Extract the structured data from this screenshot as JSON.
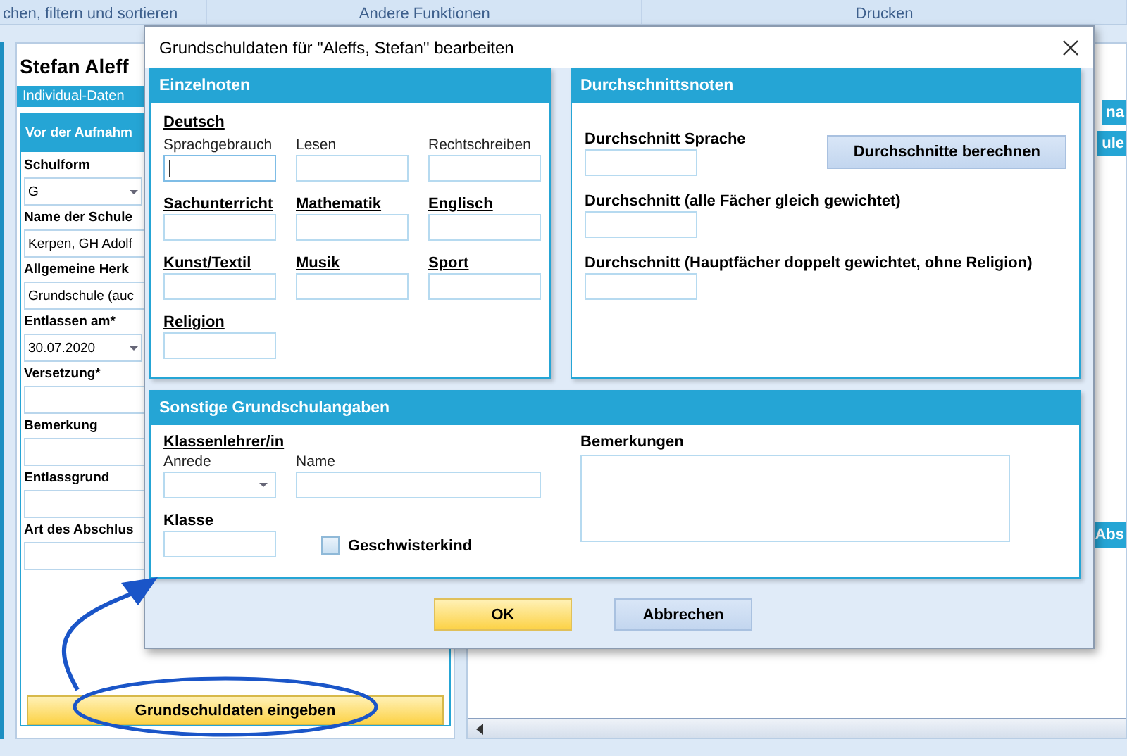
{
  "app": {
    "toolbar": [
      {
        "label": "chen, filtern und sortieren"
      },
      {
        "label": "Andere Funktionen"
      },
      {
        "label": "Drucken"
      }
    ],
    "student_name": "Stefan Aleff",
    "tab": "Individual-Daten",
    "section_title": "Vor der Aufnahm",
    "fields": [
      {
        "label": "Schulform",
        "value": "G",
        "kind": "select"
      },
      {
        "label": "Name der Schule",
        "value": "Kerpen, GH Adolf",
        "kind": "text"
      },
      {
        "label": "Allgemeine Herk",
        "value": "Grundschule (auc",
        "kind": "text"
      },
      {
        "label": "Entlassen am*",
        "value": "30.07.2020",
        "kind": "select"
      },
      {
        "label": "Versetzung*",
        "kind": "text"
      },
      {
        "label": "Bemerkung",
        "kind": "text"
      },
      {
        "label": "Entlassgrund",
        "kind": "text"
      },
      {
        "label": "Art des Abschlus",
        "kind": "text"
      }
    ],
    "action_button": "Grundschuldaten eingeben",
    "right_tabs": [
      "na",
      "ule",
      "Abs"
    ]
  },
  "dialog": {
    "title": "Grundschuldaten für \"Aleffs, Stefan\" bearbeiten",
    "einzelnoten": {
      "title": "Einzelnoten",
      "group_title": "Deutsch",
      "group_fields": [
        {
          "label": "Sprachgebrauch",
          "focused": true
        },
        {
          "label": "Lesen",
          "focused": false
        },
        {
          "label": "Rechtschreiben",
          "focused": false
        }
      ],
      "subjects": [
        {
          "label": "Sachunterricht"
        },
        {
          "label": "Mathematik"
        },
        {
          "label": "Englisch"
        },
        {
          "label": "Kunst/Textil"
        },
        {
          "label": "Musik"
        },
        {
          "label": "Sport"
        },
        {
          "label": "Religion"
        }
      ]
    },
    "durchschnitt": {
      "title": "Durchschnittsnoten",
      "button": "Durchschnitte berechnen",
      "items": [
        {
          "label": "Durchschnitt Sprache"
        },
        {
          "label": "Durchschnitt (alle Fächer gleich gewichtet)"
        },
        {
          "label": "Durchschnitt (Hauptfächer doppelt gewichtet, ohne Religion)"
        }
      ]
    },
    "sonstige": {
      "title": "Sonstige Grundschulangaben",
      "teacher_heading": "Klassenlehrer/in",
      "salutation_label": "Anrede",
      "name_label": "Name",
      "class_label": "Klasse",
      "sibling": {
        "label": "Geschwisterkind",
        "checked": false
      },
      "remarks_label": "Bemerkungen"
    },
    "buttons": [
      {
        "label": "OK",
        "kind": "primary"
      },
      {
        "label": "Abbrechen",
        "kind": "secondary"
      }
    ]
  }
}
